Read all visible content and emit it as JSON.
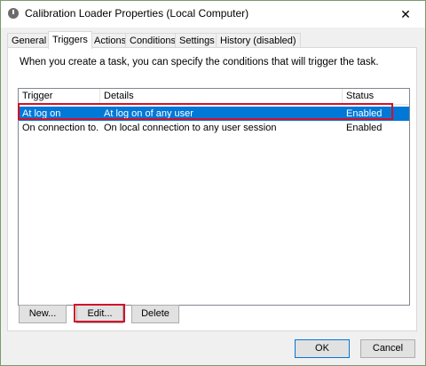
{
  "window": {
    "title": "Calibration Loader Properties (Local Computer)",
    "close_glyph": "✕"
  },
  "tabs": [
    {
      "label": "General"
    },
    {
      "label": "Triggers"
    },
    {
      "label": "Actions"
    },
    {
      "label": "Conditions"
    },
    {
      "label": "Settings"
    },
    {
      "label": "History (disabled)"
    }
  ],
  "active_tab": "Triggers",
  "description": "When you create a task, you can specify the conditions that will trigger the task.",
  "table": {
    "columns": [
      "Trigger",
      "Details",
      "Status"
    ],
    "rows": [
      {
        "trigger": "At log on",
        "details": "At log on of any user",
        "status": "Enabled"
      },
      {
        "trigger": "On connection to...",
        "details": "On local connection to any user session",
        "status": "Enabled"
      }
    ]
  },
  "buttons": {
    "new": "New...",
    "edit": "Edit...",
    "delete": "Delete",
    "ok": "OK",
    "cancel": "Cancel"
  },
  "colors": {
    "selection": "#0078d7",
    "highlight": "#d0122a"
  }
}
